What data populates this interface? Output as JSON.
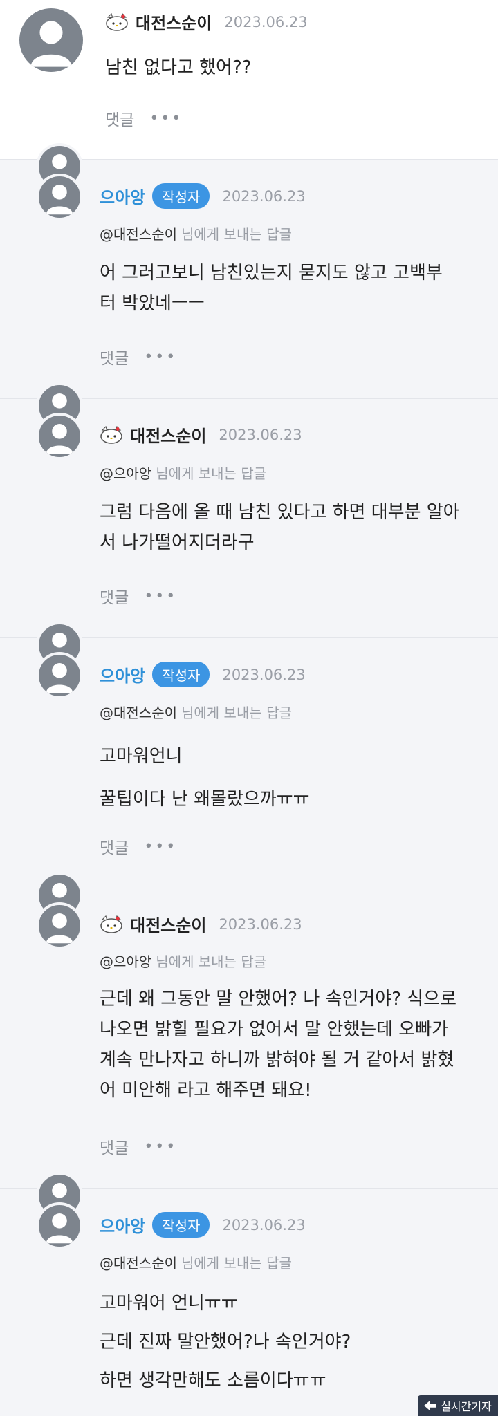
{
  "comments": [
    {
      "name": "대전스순이",
      "date": "2023.06.23",
      "lines": [
        "남친 없다고 했어??"
      ],
      "reply_label": "댓글",
      "more": "•••"
    },
    {
      "name": "으아앙",
      "badge": "작성자",
      "date": "2023.06.23",
      "mention": "@대전스순이",
      "mention_suffix": "님에게 보내는 답글",
      "lines": [
        "어 그러고보니 남친있는지 묻지도 않고 고백부",
        "터 박았네ㅡㅡ"
      ],
      "reply_label": "댓글",
      "more": "•••"
    },
    {
      "name": "대전스순이",
      "date": "2023.06.23",
      "mention": "@으아앙",
      "mention_suffix": "님에게 보내는 답글",
      "lines": [
        "그럼 다음에 올 때 남친 있다고 하면 대부분 알아",
        "서 나가떨어지더라구"
      ],
      "reply_label": "댓글",
      "more": "•••"
    },
    {
      "name": "으아앙",
      "badge": "작성자",
      "date": "2023.06.23",
      "mention": "@대전스순이",
      "mention_suffix": "님에게 보내는 답글",
      "lines": [
        "고마워언니",
        "꿀팁이다 난 왜몰랐으까ㅠㅠ"
      ],
      "reply_label": "댓글",
      "more": "•••"
    },
    {
      "name": "대전스순이",
      "date": "2023.06.23",
      "mention": "@으아앙",
      "mention_suffix": "님에게 보내는 답글",
      "lines": [
        "근데 왜 그동안 말 안했어? 나 속인거야? 식으로",
        "나오면 밝힐 필요가 없어서 말 안했는데 오빠가",
        "계속 만나자고 하니까 밝혀야 될 거 같아서 밝혔",
        "어 미안해 라고 해주면 돼요!"
      ],
      "reply_label": "댓글",
      "more": "•••"
    },
    {
      "name": "으아앙",
      "badge": "작성자",
      "date": "2023.06.23",
      "mention": "@대전스순이",
      "mention_suffix": "님에게 보내는 답글",
      "lines": [
        "고마워어 언니ㅠㅠ",
        "근데 진짜 말안했어?나 속인거야?",
        "하면 생각만해도 소름이다ㅠㅠ"
      ]
    }
  ],
  "watermark": "실시간기자",
  "colors": {
    "author_name": "#2e90d8",
    "author_badge": "#3c95e3",
    "reply_background": "#f4f5f8",
    "avatar": "#7d848d"
  }
}
